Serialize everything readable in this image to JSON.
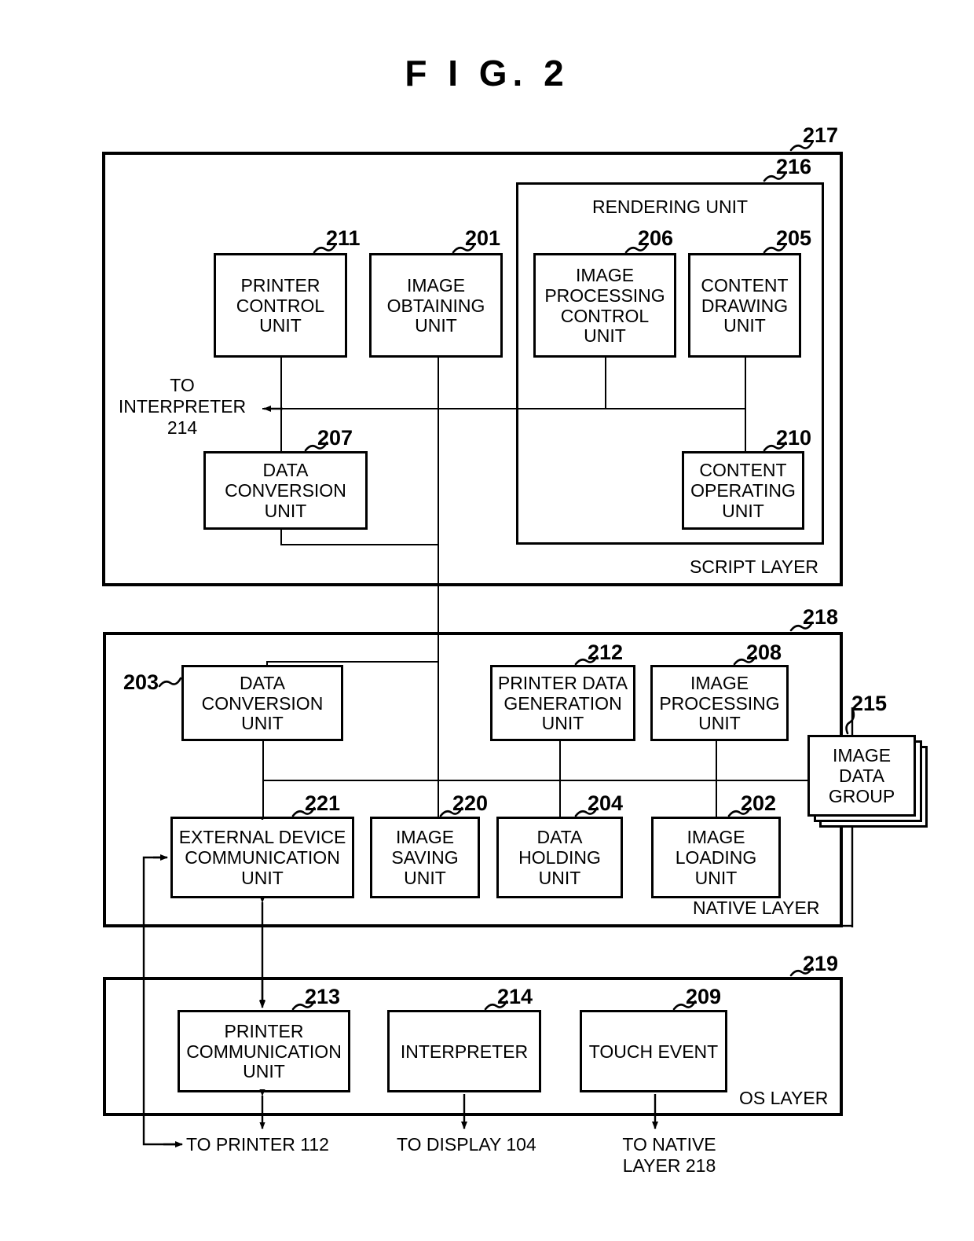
{
  "figure": {
    "title": "F I G.  2"
  },
  "layers": [
    {
      "id": "script-layer",
      "ref": "217",
      "label": "SCRIPT LAYER"
    },
    {
      "id": "native-layer",
      "ref": "218",
      "label": "NATIVE LAYER"
    },
    {
      "id": "os-layer",
      "ref": "219",
      "label": "OS LAYER"
    }
  ],
  "groups": [
    {
      "id": "rendering-unit",
      "ref": "216",
      "label": "RENDERING UNIT"
    }
  ],
  "blocks": {
    "printer_control_unit": {
      "ref": "211",
      "label": "PRINTER\nCONTROL\nUNIT"
    },
    "image_obtaining_unit": {
      "ref": "201",
      "label": "IMAGE\nOBTAINING\nUNIT"
    },
    "image_processing_control_unit": {
      "ref": "206",
      "label": "IMAGE\nPROCESSING\nCONTROL\nUNIT"
    },
    "content_drawing_unit": {
      "ref": "205",
      "label": "CONTENT\nDRAWING\nUNIT"
    },
    "data_conversion_unit_script": {
      "ref": "207",
      "label": "DATA\nCONVERSION\nUNIT"
    },
    "content_operating_unit": {
      "ref": "210",
      "label": "CONTENT\nOPERATING\nUNIT"
    },
    "data_conversion_unit_native": {
      "ref": "203",
      "label": "DATA\nCONVERSION\nUNIT"
    },
    "printer_data_generation_unit": {
      "ref": "212",
      "label": "PRINTER DATA\nGENERATION\nUNIT"
    },
    "image_processing_unit": {
      "ref": "208",
      "label": "IMAGE\nPROCESSING\nUNIT"
    },
    "image_data_group": {
      "ref": "215",
      "label": "IMAGE\nDATA\nGROUP"
    },
    "external_device_communication_unit": {
      "ref": "221",
      "label": "EXTERNAL DEVICE\nCOMMUNICATION\nUNIT"
    },
    "image_saving_unit": {
      "ref": "220",
      "label": "IMAGE\nSAVING\nUNIT"
    },
    "data_holding_unit": {
      "ref": "204",
      "label": "DATA\nHOLDING\nUNIT"
    },
    "image_loading_unit": {
      "ref": "202",
      "label": "IMAGE\nLOADING\nUNIT"
    },
    "printer_communication_unit": {
      "ref": "213",
      "label": "PRINTER\nCOMMUNICATION\nUNIT"
    },
    "interpreter": {
      "ref": "214",
      "label": "INTERPRETER"
    },
    "touch_event": {
      "ref": "209",
      "label": "TOUCH EVENT"
    }
  },
  "annotations": {
    "to_interpreter": "TO\nINTERPRETER\n214",
    "to_printer": "TO PRINTER 112",
    "to_display": "TO DISPLAY 104",
    "to_native_layer": "TO NATIVE\nLAYER 218"
  }
}
